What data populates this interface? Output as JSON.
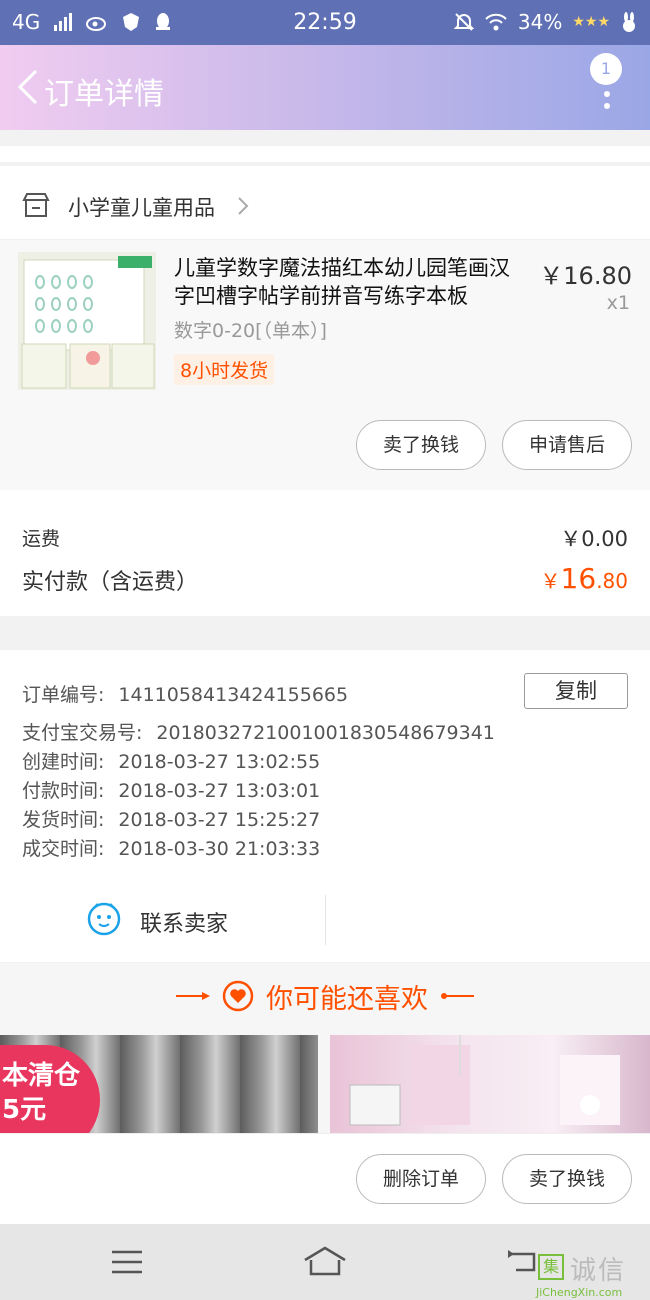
{
  "status_bar": {
    "network": "4G",
    "time": "22:59",
    "battery": "34%"
  },
  "header": {
    "title": "订单详情",
    "notification_count": "1"
  },
  "shop": {
    "name": "小学童儿童用品"
  },
  "product": {
    "title": "儿童学数字魔法描红本幼儿园笔画汉字凹槽字帖学前拼音写练字本板",
    "spec": "数字0-20[（单本）]",
    "tag": "8小时发货",
    "price": "￥16.80",
    "quantity": "x1",
    "buttons": [
      "卖了换钱",
      "申请售后"
    ]
  },
  "totals": {
    "shipping_label": "运费",
    "shipping_value": "￥0.00",
    "paid_label": "实付款（含运费）",
    "paid_currency": "￥",
    "paid_integer": "16",
    "paid_decimal": ".80"
  },
  "order_info": {
    "copy_label": "复制",
    "rows": [
      {
        "label": "订单编号:",
        "value": "1411058413424155665"
      },
      {
        "label": "支付宝交易号:",
        "value": "2018032721001001830548679341"
      },
      {
        "label": "创建时间:",
        "value": "2018-03-27 13:02:55"
      },
      {
        "label": "付款时间:",
        "value": "2018-03-27 13:03:01"
      },
      {
        "label": "发货时间:",
        "value": "2018-03-27 15:25:27"
      },
      {
        "label": "成交时间:",
        "value": "2018-03-30 21:03:33"
      }
    ],
    "contact_label": "联系卖家"
  },
  "recommend": {
    "title": "你可能还喜欢",
    "banner_line1": "本清仓",
    "banner_line2": "5元"
  },
  "bottom_actions": [
    "删除订单",
    "卖了换钱"
  ],
  "watermark": {
    "text": "诚信",
    "logo_char": "集",
    "domain": "JiChengXin.com"
  },
  "colors": {
    "accent": "#ff5000",
    "status_bar": "#5f70b5",
    "header_gradient_start": "#f1ccf0",
    "header_gradient_end": "#9aa7e6"
  }
}
